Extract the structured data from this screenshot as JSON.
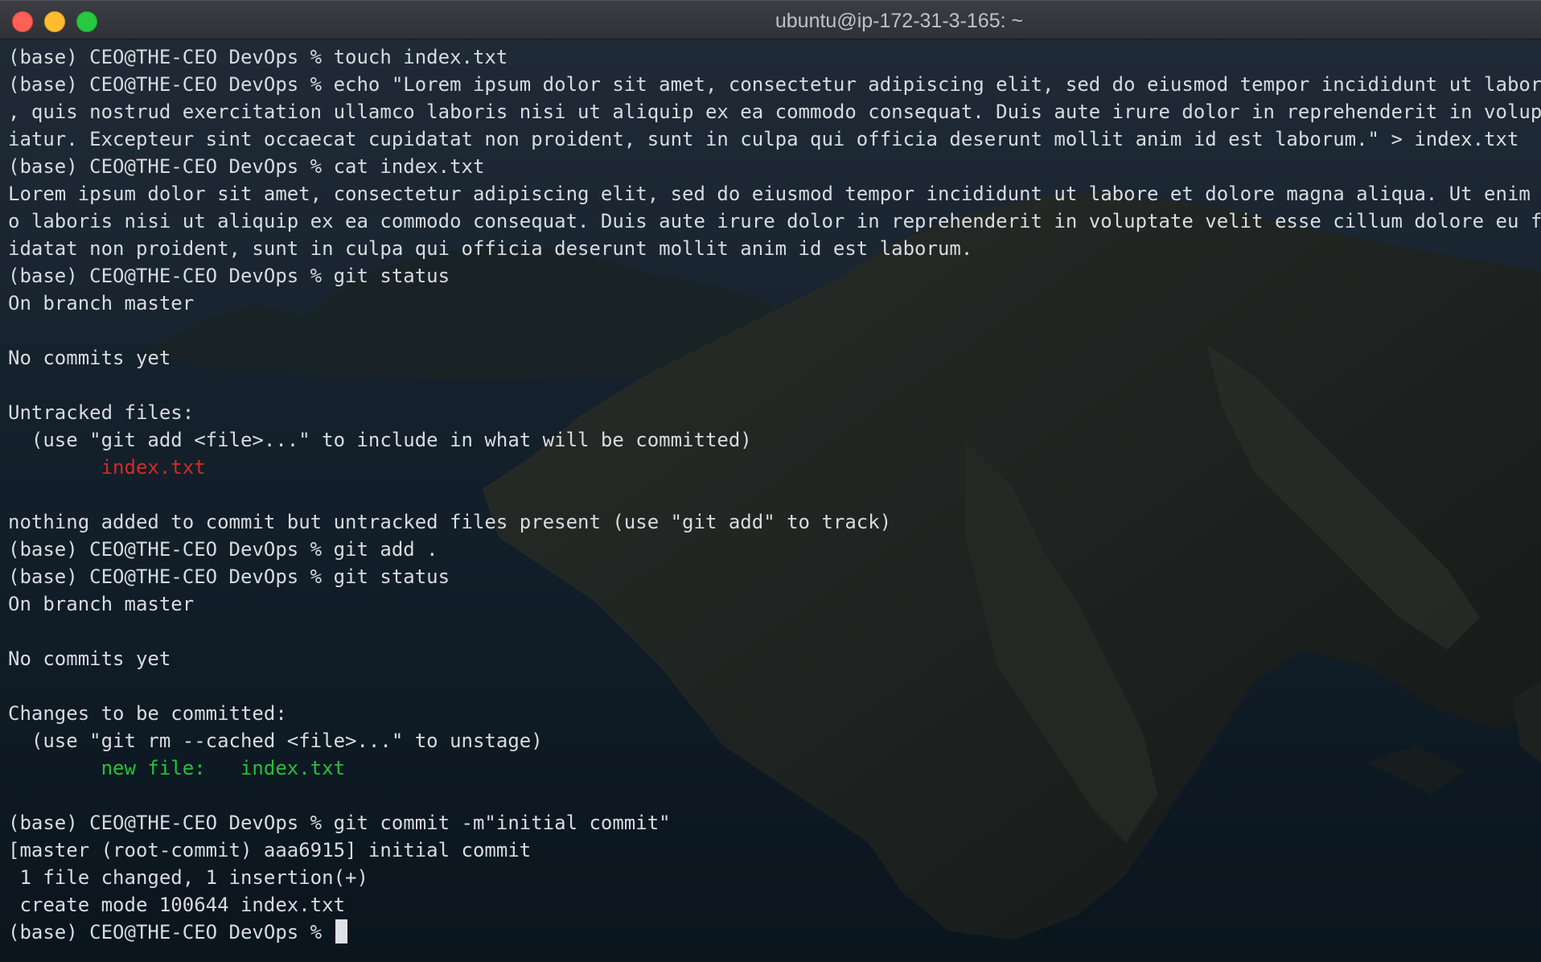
{
  "window": {
    "title": "ubuntu@ip-172-31-3-165: ~"
  },
  "terminal": {
    "lines": [
      {
        "text": "(base) CEO@THE-CEO DevOps % touch index.txt",
        "style": ""
      },
      {
        "text": "(base) CEO@THE-CEO DevOps % echo \"Lorem ipsum dolor sit amet, consectetur adipiscing elit, sed do eiusmod tempor incididunt ut labore et",
        "style": ""
      },
      {
        "text": ", quis nostrud exercitation ullamco laboris nisi ut aliquip ex ea commodo consequat. Duis aute irure dolor in reprehenderit in voluptate",
        "style": ""
      },
      {
        "text": "iatur. Excepteur sint occaecat cupidatat non proident, sunt in culpa qui officia deserunt mollit anim id est laborum.\" > index.txt",
        "style": ""
      },
      {
        "text": "(base) CEO@THE-CEO DevOps % cat index.txt",
        "style": ""
      },
      {
        "text": "Lorem ipsum dolor sit amet, consectetur adipiscing elit, sed do eiusmod tempor incididunt ut labore et dolore magna aliqua. Ut enim ad m",
        "style": ""
      },
      {
        "text": "o laboris nisi ut aliquip ex ea commodo consequat. Duis aute irure dolor in reprehenderit in voluptate velit esse cillum dolore eu fugia",
        "style": ""
      },
      {
        "text": "idatat non proident, sunt in culpa qui officia deserunt mollit anim id est laborum.",
        "style": ""
      },
      {
        "text": "(base) CEO@THE-CEO DevOps % git status",
        "style": ""
      },
      {
        "text": "On branch master",
        "style": ""
      },
      {
        "text": "",
        "style": ""
      },
      {
        "text": "No commits yet",
        "style": ""
      },
      {
        "text": "",
        "style": ""
      },
      {
        "text": "Untracked files:",
        "style": ""
      },
      {
        "text": "  (use \"git add <file>...\" to include in what will be committed)",
        "style": ""
      },
      {
        "text": "        index.txt",
        "style": "red"
      },
      {
        "text": "",
        "style": ""
      },
      {
        "text": "nothing added to commit but untracked files present (use \"git add\" to track)",
        "style": ""
      },
      {
        "text": "(base) CEO@THE-CEO DevOps % git add .",
        "style": ""
      },
      {
        "text": "(base) CEO@THE-CEO DevOps % git status",
        "style": ""
      },
      {
        "text": "On branch master",
        "style": ""
      },
      {
        "text": "",
        "style": ""
      },
      {
        "text": "No commits yet",
        "style": ""
      },
      {
        "text": "",
        "style": ""
      },
      {
        "text": "Changes to be committed:",
        "style": ""
      },
      {
        "text": "  (use \"git rm --cached <file>...\" to unstage)",
        "style": ""
      },
      {
        "text": "        new file:   index.txt",
        "style": "green"
      },
      {
        "text": "",
        "style": ""
      },
      {
        "text": "(base) CEO@THE-CEO DevOps % git commit -m\"initial commit\"",
        "style": ""
      },
      {
        "text": "[master (root-commit) aaa6915] initial commit",
        "style": ""
      },
      {
        "text": " 1 file changed, 1 insertion(+)",
        "style": ""
      },
      {
        "text": " create mode 100644 index.txt",
        "style": ""
      }
    ],
    "prompt": "(base) CEO@THE-CEO DevOps % "
  },
  "colors": {
    "text": "#d8dbe0",
    "untracked": "#d22a28",
    "staged": "#23c23a",
    "titlebar": "#35373c"
  }
}
